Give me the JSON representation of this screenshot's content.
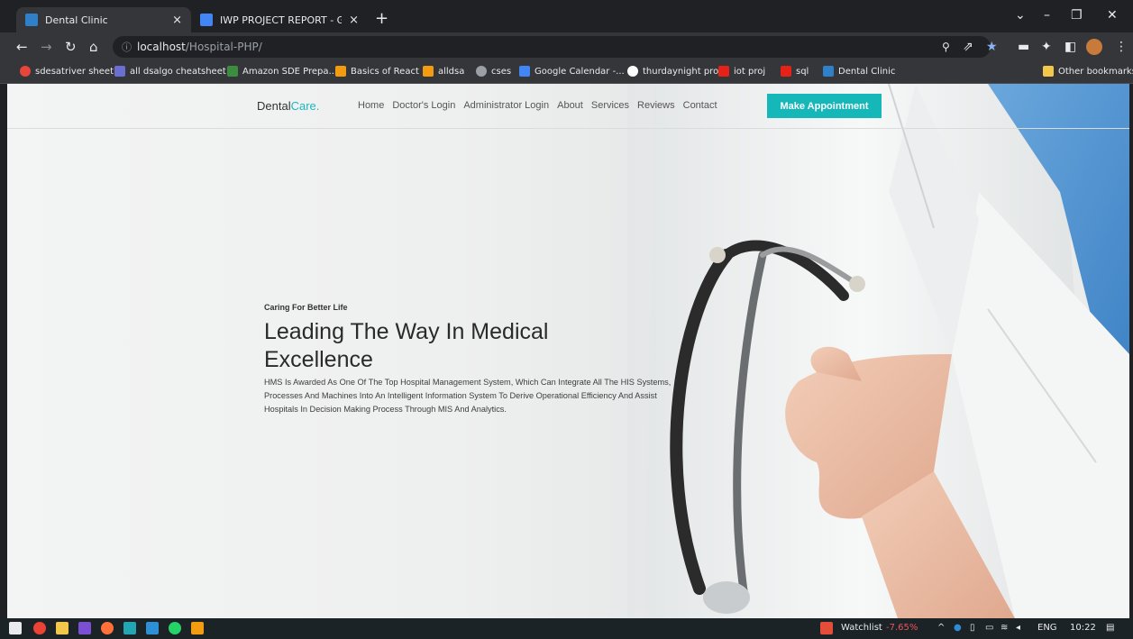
{
  "browser": {
    "tabs": [
      {
        "title": "Dental Clinic",
        "close": "×"
      },
      {
        "title": "IWP PROJECT REPORT - Google D",
        "close": "×"
      }
    ],
    "new_tab": "+",
    "window_controls": {
      "chevron": "⌄",
      "minimize": "–",
      "restore": "❐",
      "close": "✕"
    },
    "address": {
      "info_icon": "ⓘ",
      "host": "localhost",
      "path": "/Hospital-PHP/"
    },
    "bookmarks": [
      "sdesatriver sheet",
      "all dsalgo cheatsheet",
      "Amazon SDE Prepa...",
      "Basics of React",
      "alldsa",
      "cses",
      "Google Calendar -...",
      "thurdaynight proj",
      "iot proj",
      "sql",
      "Dental Clinic"
    ],
    "other_bookmarks": "Other bookmarks",
    "colors": {
      "chrome": "#35363a",
      "tabbar": "#202124"
    }
  },
  "site": {
    "brand_main": "Dental",
    "brand_accent": "Care.",
    "nav_items": [
      "Home",
      "Doctor's Login",
      "Administrator Login",
      "About",
      "Services",
      "Reviews",
      "Contact"
    ],
    "cta": "Make Appointment",
    "hero": {
      "eyebrow": "Caring For Better Life",
      "title": "Leading The Way In Medical Excellence",
      "description": "HMS Is Awarded As One Of The Top Hospital Management System, Which Can Integrate All The HIS Systems, Processes And Machines Into An Intelligent Information System To Derive Operational Efficiency And Assist Hospitals In Decision Making Process Through MIS And Analytics."
    },
    "colors": {
      "accent": "#15b7b9"
    }
  },
  "taskbar": {
    "watchlist_label": "Watchlist",
    "watchlist_value": "-7.65%",
    "language": "ENG",
    "time": "10:22"
  }
}
